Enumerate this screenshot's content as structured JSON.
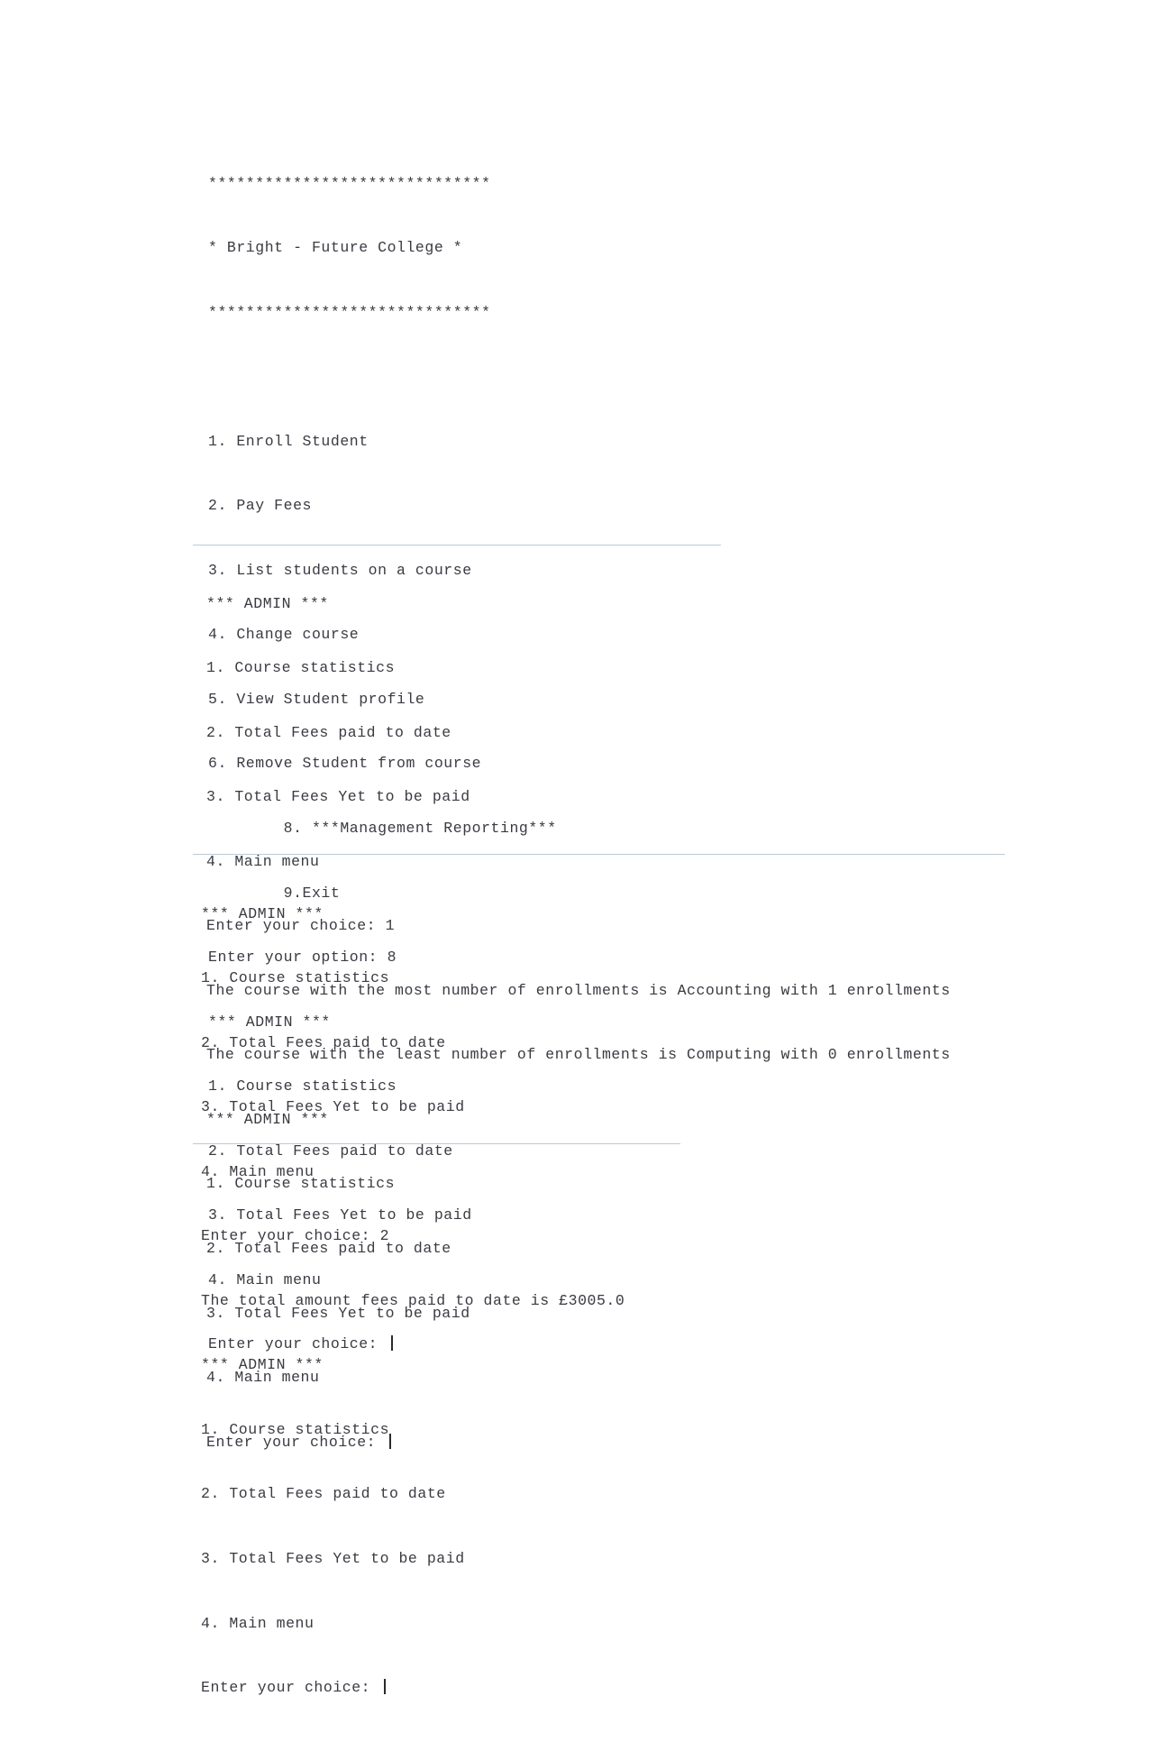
{
  "document": {
    "type": "console-transcript",
    "background_color": "#ffffff",
    "text_color": "#3a3a42",
    "divider_color": "#b8cada"
  },
  "banner": {
    "top_rule": "******************************",
    "title_line": "* Bright - Future College *",
    "bottom_rule": "******************************"
  },
  "main_menu": {
    "items": [
      "1. Enroll Student",
      "2. Pay Fees",
      "3. List students on a course",
      "4. Change course",
      "5. View Student profile",
      "6. Remove Student from course",
      "        8. ***Management Reporting***",
      "        9.Exit"
    ],
    "prompt": "Enter your option: 8"
  },
  "admin_menu": {
    "heading": "*** ADMIN ***",
    "items": [
      "1. Course statistics",
      "2. Total Fees paid to date",
      "3. Total Fees Yet to be paid",
      "4. Main menu"
    ],
    "prompt_label": "Enter your choice:",
    "prompt_choice_1": "Enter your choice: 1",
    "prompt_choice_2": "Enter your choice: 2",
    "prompt_empty": "Enter your choice: "
  },
  "results": {
    "most_enrollments": "The course with the most number of enrollments is Accounting with 1 enrollments",
    "least_enrollments": "The course with the least number of enrollments is Computing with 0 enrollments",
    "total_fees_paid": "The total amount fees paid to date is £3005.0"
  },
  "blocks": [
    {
      "id": "block-1",
      "lines": [
        "******************************",
        "* Bright - Future College *",
        "******************************",
        "",
        "1. Enroll Student",
        "2. Pay Fees",
        "3. List students on a course",
        "4. Change course",
        "5. View Student profile",
        "6. Remove Student from course",
        "        8. ***Management Reporting***",
        "        9.Exit",
        "Enter your option: 8",
        "*** ADMIN ***",
        "1. Course statistics",
        "2. Total Fees paid to date",
        "3. Total Fees Yet to be paid",
        "4. Main menu",
        "Enter your choice: "
      ]
    },
    {
      "id": "block-2",
      "lines": [
        "*** ADMIN ***",
        "1. Course statistics",
        "2. Total Fees paid to date",
        "3. Total Fees Yet to be paid",
        "4. Main menu",
        "Enter your choice: 1",
        "The course with the most number of enrollments is Accounting with 1 enrollments",
        "The course with the least number of enrollments is Computing with 0 enrollments",
        "*** ADMIN ***",
        "1. Course statistics",
        "2. Total Fees paid to date",
        "3. Total Fees Yet to be paid",
        "4. Main menu",
        "Enter your choice: "
      ]
    },
    {
      "id": "block-3",
      "lines": [
        "*** ADMIN ***",
        "1. Course statistics",
        "2. Total Fees paid to date",
        "3. Total Fees Yet to be paid",
        "4. Main menu",
        "Enter your choice: 2",
        "The total amount fees paid to date is £3005.0",
        "*** ADMIN ***",
        "1. Course statistics",
        "2. Total Fees paid to date",
        "3. Total Fees Yet to be paid",
        "4. Main menu",
        "Enter your choice: "
      ]
    }
  ]
}
